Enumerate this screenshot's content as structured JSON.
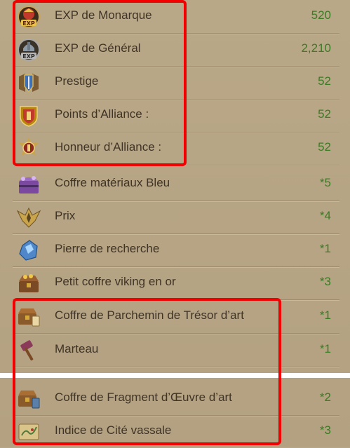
{
  "rewards": {
    "items": [
      {
        "label": "EXP de Monarque",
        "value": "520",
        "icon": "monarch-exp-icon"
      },
      {
        "label": "EXP de Général",
        "value": "2,210",
        "icon": "general-exp-icon"
      },
      {
        "label": "Prestige",
        "value": "52",
        "icon": "prestige-icon"
      },
      {
        "label": "Points d’Alliance :",
        "value": "52",
        "icon": "alliance-points-icon"
      },
      {
        "label": "Honneur d’Alliance :",
        "value": "52",
        "icon": "alliance-honor-icon"
      },
      {
        "label": "Coffre matériaux Bleu",
        "value": "*5",
        "icon": "blue-material-chest-icon"
      },
      {
        "label": "Prix",
        "value": "*4",
        "icon": "prize-emblem-icon"
      },
      {
        "label": "Pierre de recherche",
        "value": "*1",
        "icon": "research-stone-icon"
      },
      {
        "label": "Petit coffre viking en or",
        "value": "*3",
        "icon": "viking-gold-chest-icon"
      },
      {
        "label": "Coffre de Parchemin de Trésor d’art",
        "value": "*1",
        "icon": "art-treasure-scroll-chest-icon"
      },
      {
        "label": "Marteau",
        "value": "*1",
        "icon": "hammer-icon"
      },
      {
        "label": "Coffre de Fragment d’Œuvre d’art",
        "value": "*2",
        "icon": "artwork-fragment-chest-icon"
      },
      {
        "label": "Indice de Cité vassale",
        "value": "*3",
        "icon": "vassal-city-clue-map-icon"
      }
    ]
  },
  "colors": {
    "highlight": "#f00000",
    "value_text": "#3c7a24",
    "label_text": "#3f3426",
    "panel_bg": "#b6a586"
  }
}
